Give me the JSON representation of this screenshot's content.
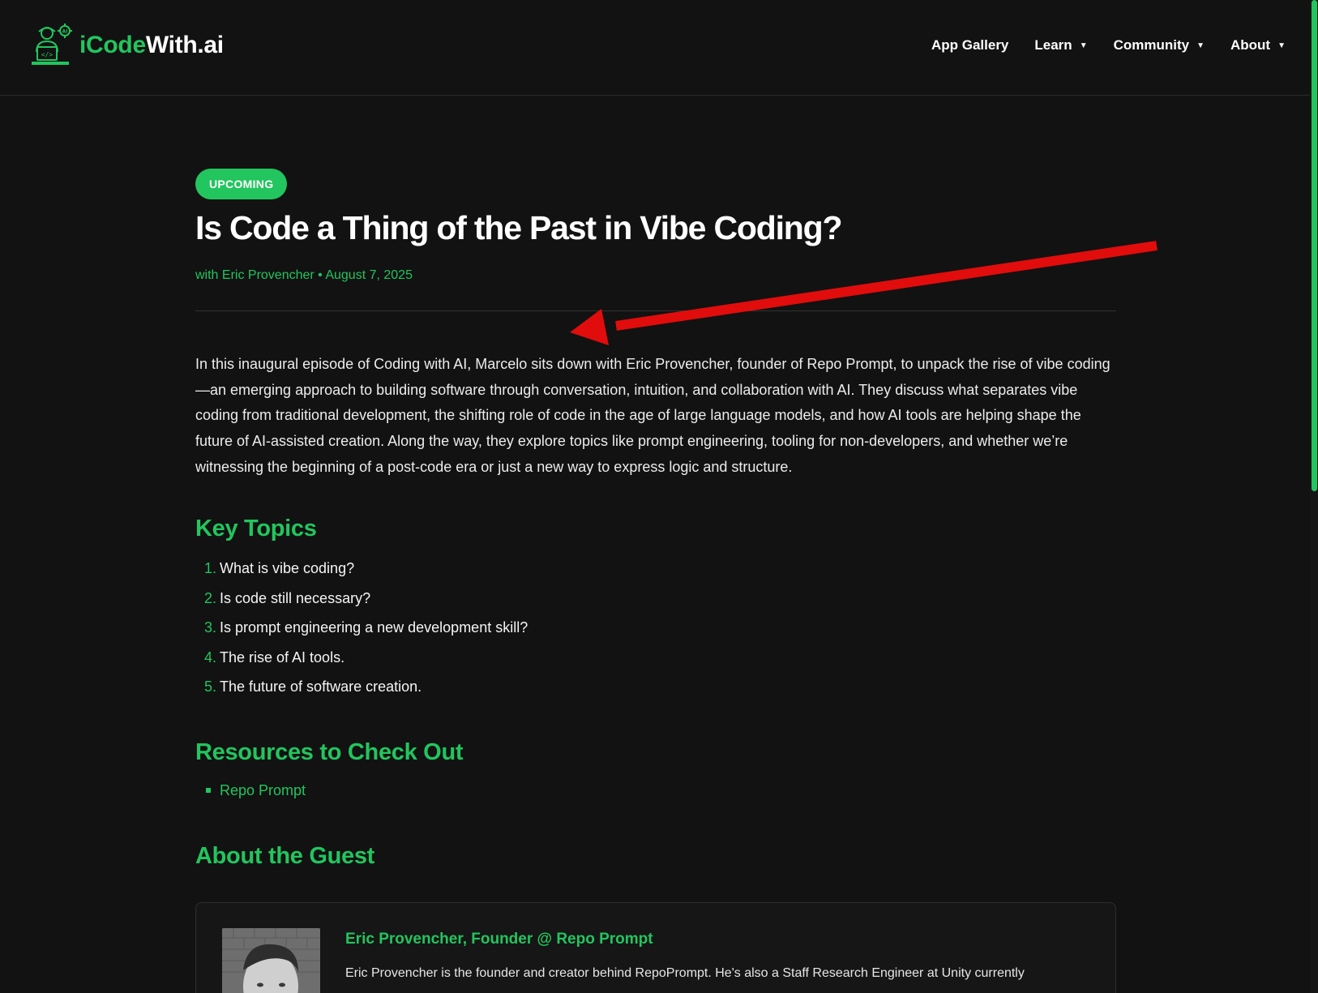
{
  "header": {
    "logo": {
      "part1": "iCode",
      "part2": "With.ai"
    },
    "nav": [
      {
        "label": "App Gallery",
        "dropdown": false
      },
      {
        "label": "Learn",
        "dropdown": true
      },
      {
        "label": "Community",
        "dropdown": true
      },
      {
        "label": "About",
        "dropdown": true
      }
    ]
  },
  "episode": {
    "badge": "UPCOMING",
    "title": "Is Code a Thing of the Past in Vibe Coding?",
    "meta": "with Eric Provencher • August 7, 2025",
    "intro": "In this inaugural episode of Coding with AI, Marcelo sits down with Eric Provencher, founder of Repo Prompt, to unpack the rise of vibe coding—an emerging approach to building software through conversation, intuition, and collaboration with AI. They discuss what separates vibe coding from traditional development, the shifting role of code in the age of large language models, and how AI tools are helping shape the future of AI-assisted creation. Along the way, they explore topics like prompt engineering, tooling for non-developers, and whether we’re witnessing the beginning of a post-code era or just a new way to express logic and structure."
  },
  "key_topics": {
    "heading": "Key Topics",
    "items": [
      {
        "num": "1.",
        "text": "What is vibe coding?"
      },
      {
        "num": "2.",
        "text": "Is code still necessary?"
      },
      {
        "num": "3.",
        "text": "Is prompt engineering a new development skill?"
      },
      {
        "num": "4.",
        "text": "The rise of AI tools."
      },
      {
        "num": "5.",
        "text": "The future of software creation."
      }
    ]
  },
  "resources": {
    "heading": "Resources to Check Out",
    "items": [
      {
        "text": "Repo Prompt"
      }
    ]
  },
  "guest": {
    "heading": "About the Guest",
    "name": "Eric Provencher, Founder @ Repo Prompt",
    "bio": "Eric Provencher is the founder and creator behind RepoPrompt. He's also a Staff Research Engineer at Unity currently"
  },
  "colors": {
    "accent": "#22c55e",
    "background": "#121212",
    "annotation": "#e10c0c"
  }
}
